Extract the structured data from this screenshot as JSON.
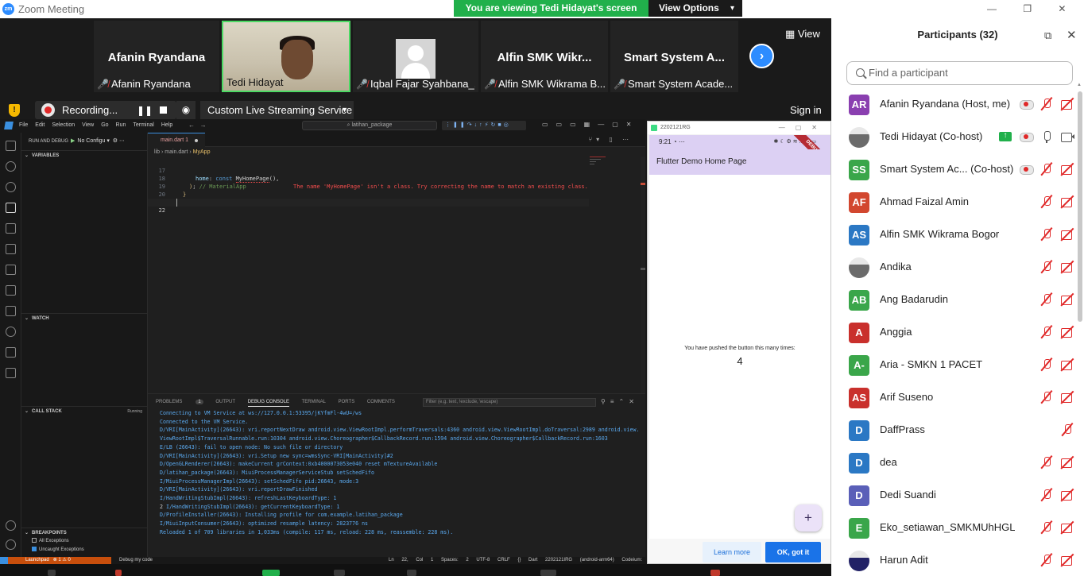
{
  "window": {
    "title": "Zoom Meeting",
    "share_banner": "You are viewing Tedi Hidayat's screen",
    "view_options": "View Options"
  },
  "video_strip": {
    "tiles": [
      {
        "big_name": "Afanin Ryandana",
        "label": "Afanin Ryandana"
      },
      {
        "big_name": "",
        "label": "Tedi Hidayat"
      },
      {
        "big_name": "",
        "label": "Iqbal Fajar Syahbana_..."
      },
      {
        "big_name": "Alfin SMK Wikr...",
        "label": "Alfin SMK Wikrama B..."
      },
      {
        "big_name": "Smart System A...",
        "label": "Smart System Acade..."
      }
    ],
    "view_label": "View"
  },
  "toolbar": {
    "recording_label": "Recording...",
    "stream_label": "Custom Live Streaming Service",
    "signin": "Sign in"
  },
  "vscode": {
    "menu": [
      "File",
      "Edit",
      "Selection",
      "View",
      "Go",
      "Run",
      "Terminal",
      "Help"
    ],
    "search": "latihan_package",
    "run_debug_header": "RUN AND DEBUG",
    "run_config": "No Configu",
    "sections": {
      "variables": "VARIABLES",
      "watch": "WATCH",
      "call_stack": "CALL STACK",
      "running": "Running",
      "breakpoints": "BREAKPOINTS"
    },
    "breakpoints": [
      "All Exceptions",
      "Uncaught Exceptions"
    ],
    "tab": {
      "name": "main.dart",
      "count": "1"
    },
    "breadcrumb": {
      "root": "lib",
      "file": "main.dart",
      "class": "MyApp"
    },
    "code": [
      {
        "n": "17",
        "text": "home: const MyHomePage(),",
        "error": "The name 'MyHomePage' isn't a class. Try correcting the name to match an existing class."
      },
      {
        "n": "18",
        "text": "); // MaterialApp"
      },
      {
        "n": "19",
        "text": "}"
      },
      {
        "n": "20",
        "text": "}"
      },
      {
        "n": "21",
        "text": ""
      },
      {
        "n": "22",
        "text": ""
      }
    ],
    "panel_tabs": [
      "PROBLEMS",
      "OUTPUT",
      "DEBUG CONSOLE",
      "TERMINAL",
      "PORTS",
      "COMMENTS"
    ],
    "problems_count": "1",
    "filter_placeholder": "Filter (e.g. text, !exclude, \\escape)",
    "console_lines": [
      "Connecting to VM Service at ws://127.0.0.1:53395/jKYfmFl-4wU=/ws",
      "Connected to the VM Service.",
      "D/VRI[MainActivity](26643): vri.reportNextDraw android.view.ViewRootImpl.performTraversals:4360 android.view.ViewRootImpl.doTraversal:2989 android.view.ViewRootImpl$TraversalRunnable.run:10304 android.view.Choreographer$CallbackRecord.run:1594 android.view.Choreographer$CallbackRecord.run:1603",
      "E/LB      (26643): fail to open node: No such file or directory",
      "D/VRI[MainActivity](26643): vri.Setup new sync=wmsSync-VRI[MainActivity]#2",
      "D/OpenGLRenderer(26643): makeCurrent grContext:0xb4000073053e040 reset mTextureAvailable",
      "D/latihan_package(26643): MiuiProcessManagerServiceStub setSchedFifo",
      "I/MiuiProcessManagerImpl(26643): setSchedFifo pid:26643, mode:3",
      "D/VRI[MainActivity](26643): vri.reportDrawFinished",
      "I/HandWritingStubImpl(26643): refreshLastKeyboardType: 1",
      "I/HandWritingStubImpl(26643): getCurrentKeyboardType: 1",
      "D/ProfileInstaller(26643): Installing profile for com.example.latihan_package",
      "I/MiuiInputConsumer(26643): optimized resample latency: 2823776 ns",
      "Reloaded 1 of 709 libraries in 1,033ms (compile: 117 ms, reload: 228 ms, reassemble: 228 ms)."
    ],
    "console_gutter": "2",
    "status": {
      "launch": "Launchpad",
      "problems": "⊗ 1 ⚠ 0",
      "debug": "Debug my code",
      "right": "Ln 22, Col 1 Spaces: 2 UTF-8 CRLF {} Dart 2202121IRG (android-arm64) Codeium: Login"
    }
  },
  "emulator": {
    "title": "2202121RG",
    "time": "9:21",
    "debug_ribbon": "DEBUG",
    "app_title": "Flutter Demo Home Page",
    "pushed_text": "You have pushed the button this many times:",
    "counter": "4",
    "fab": "+",
    "learn_more": "Learn more",
    "ok": "OK, got it"
  },
  "participants": {
    "header": "Participants (32)",
    "search_placeholder": "Find a participant",
    "list": [
      {
        "initials": "AR",
        "color": "#8a3fb0",
        "name": "Afanin Ryandana (Host, me)",
        "icons": [
          "rec",
          "mic-off",
          "cam-off"
        ]
      },
      {
        "initials": "",
        "color": "#6b6b6b",
        "name": "Tedi Hidayat (Co-host)",
        "icons": [
          "share",
          "rec",
          "mic-on",
          "cam-on"
        ],
        "photo": true
      },
      {
        "initials": "SS",
        "color": "#3aa64a",
        "name": "Smart System Ac... (Co-host)",
        "icons": [
          "rec",
          "mic-off",
          "cam-off"
        ]
      },
      {
        "initials": "AF",
        "color": "#d2472f",
        "name": "Ahmad Faizal Amin",
        "icons": [
          "mic-off",
          "cam-off"
        ]
      },
      {
        "initials": "AS",
        "color": "#2b78c4",
        "name": "Alfin SMK Wikrama Bogor",
        "icons": [
          "mic-off",
          "cam-off"
        ]
      },
      {
        "initials": "",
        "color": "#6b6b6b",
        "name": "Andika",
        "icons": [
          "mic-off",
          "cam-off"
        ],
        "photo": true
      },
      {
        "initials": "AB",
        "color": "#3aa64a",
        "name": "Ang Badarudin",
        "icons": [
          "mic-off",
          "cam-off"
        ]
      },
      {
        "initials": "A",
        "color": "#c9302c",
        "name": "Anggia",
        "icons": [
          "mic-off",
          "cam-off"
        ]
      },
      {
        "initials": "A-",
        "color": "#3aa64a",
        "name": "Aria - SMKN 1 PACET",
        "icons": [
          "mic-off",
          "cam-off"
        ]
      },
      {
        "initials": "AS",
        "color": "#c9302c",
        "name": "Arif Suseno",
        "icons": [
          "mic-off",
          "cam-off"
        ]
      },
      {
        "initials": "D",
        "color": "#2b78c4",
        "name": "DaffPrass",
        "icons": [
          "mic-off"
        ]
      },
      {
        "initials": "D",
        "color": "#2b78c4",
        "name": "dea",
        "icons": [
          "mic-off",
          "cam-off"
        ]
      },
      {
        "initials": "D",
        "color": "#5a5fb8",
        "name": "Dedi Suandi",
        "icons": [
          "mic-off",
          "cam-off"
        ]
      },
      {
        "initials": "E",
        "color": "#3aa64a",
        "name": "Eko_setiawan_SMKMUhHGL",
        "icons": [
          "mic-off",
          "cam-off"
        ]
      },
      {
        "initials": "",
        "color": "#222266",
        "name": "Harun Adit",
        "icons": [
          "mic-off",
          "cam-off"
        ],
        "photo": true
      }
    ]
  }
}
